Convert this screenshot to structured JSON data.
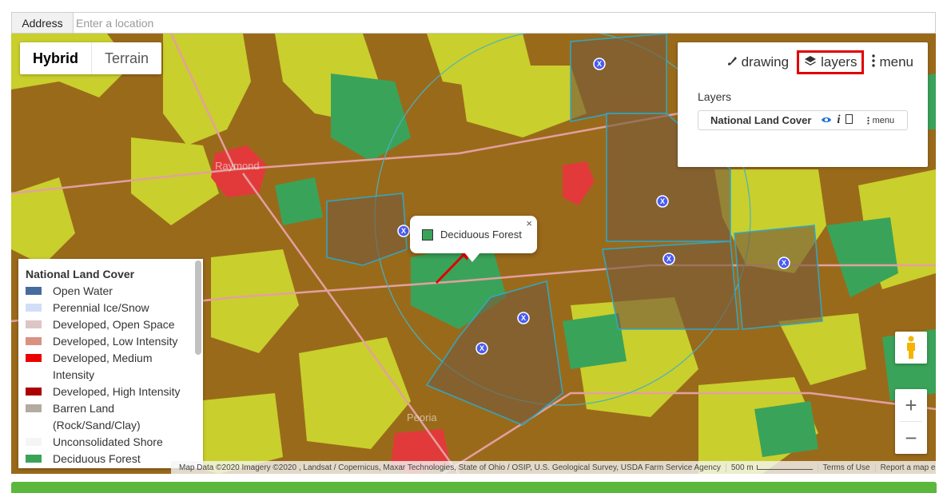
{
  "address": {
    "label": "Address",
    "placeholder": "Enter a location"
  },
  "maptype": {
    "hybrid": "Hybrid",
    "terrain": "Terrain",
    "active": "Hybrid"
  },
  "panel": {
    "drawing": "drawing",
    "layers": "layers",
    "menu": "menu",
    "layers_heading": "Layers",
    "layer_name": "National Land Cover",
    "layer_menu": "menu"
  },
  "infowindow": {
    "label": "Deciduous Forest",
    "swatch_color": "#3aa35a",
    "close": "×"
  },
  "legend": {
    "title": "National Land Cover",
    "items": [
      {
        "label": "Open Water",
        "color": "#466b9f"
      },
      {
        "label": "Perennial Ice/Snow",
        "color": "#d1def8"
      },
      {
        "label": "Developed, Open Space",
        "color": "#dec5c5"
      },
      {
        "label": "Developed, Low Intensity",
        "color": "#d99282"
      },
      {
        "label": "Developed, Medium Intensity",
        "color": "#eb0000"
      },
      {
        "label": "Developed, High Intensity",
        "color": "#ab0000"
      },
      {
        "label": "Barren Land (Rock/Sand/Clay)",
        "color": "#b3ac9f"
      },
      {
        "label": "Unconsolidated Shore",
        "color": "#f5f5f5"
      },
      {
        "label": "Deciduous Forest",
        "color": "#3aa35a"
      }
    ]
  },
  "map_labels": {
    "town1": "Raymond",
    "town2": "Peoria"
  },
  "attribution": {
    "data": "Map Data ©2020 Imagery ©2020 , Landsat / Copernicus, Maxar Technologies, State of Ohio / OSIP, U.S. Geological Survey, USDA Farm Service Agency",
    "scale": "500 m",
    "terms": "Terms of Use",
    "report": "Report a map error"
  },
  "colors": {
    "crop": "#9a6a1b",
    "pasture": "#c9cf2c",
    "forest": "#3aa35a",
    "developed": "#e23a3a",
    "highlight": "#e00000"
  }
}
